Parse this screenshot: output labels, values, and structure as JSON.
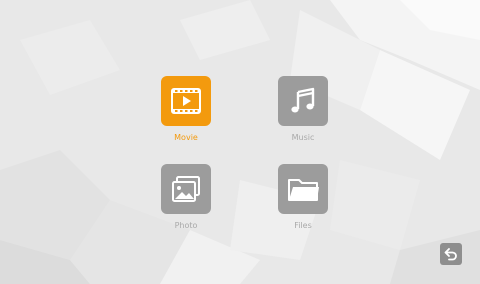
{
  "menu": {
    "items": [
      {
        "label": "Movie",
        "icon": "film-play-icon",
        "selected": true
      },
      {
        "label": "Music",
        "icon": "music-note-icon",
        "selected": false
      },
      {
        "label": "Photo",
        "icon": "photo-gallery-icon",
        "selected": false
      },
      {
        "label": "Files",
        "icon": "folder-icon",
        "selected": false
      }
    ]
  },
  "back": {
    "icon": "back-arrow-icon"
  },
  "colors": {
    "selected_tile": "#f39a0e",
    "tile": "#9c9c9c",
    "selected_label": "#f39a0e",
    "label": "#a9a9a9",
    "background": "#e9e9e9",
    "back_button": "#8e8e8e"
  }
}
